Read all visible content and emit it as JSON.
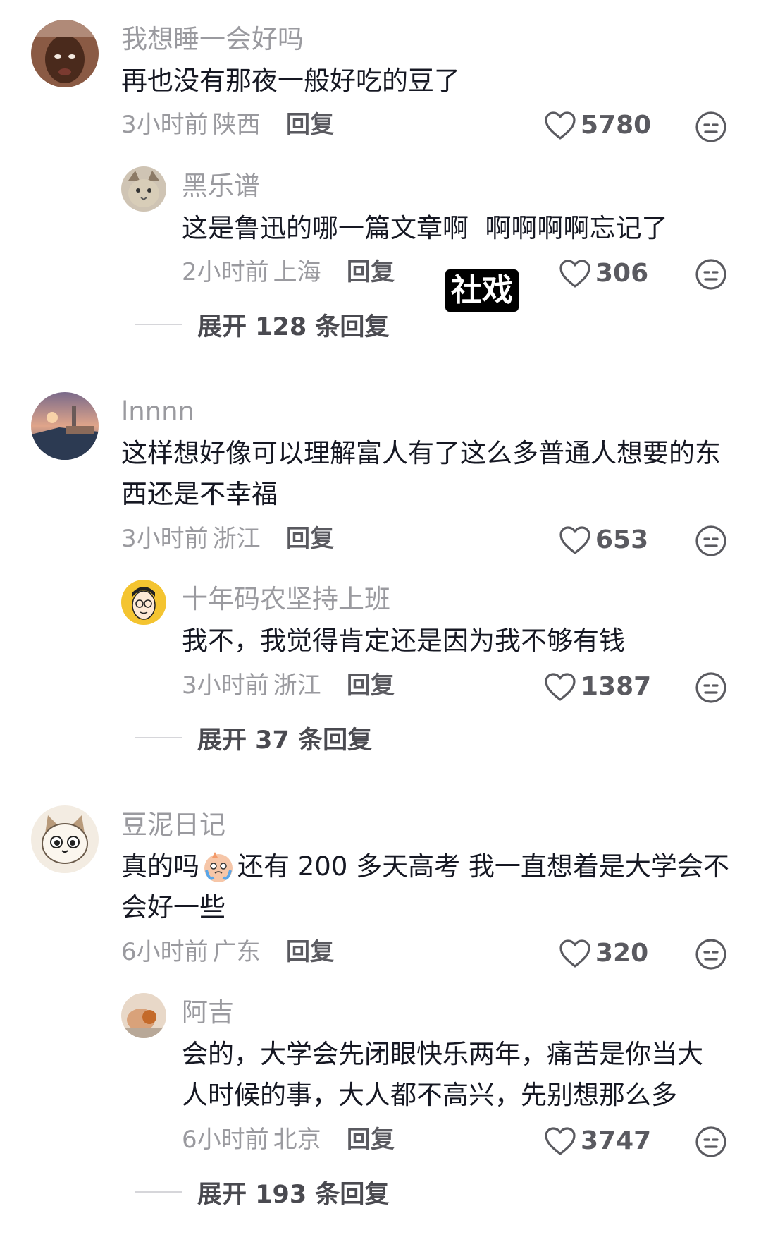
{
  "comments": [
    {
      "username": "我想睡一会好吗",
      "text": "再也没有那夜一般好吃的豆了",
      "time": "3小时前",
      "region": "陕西",
      "reply_label": "回复",
      "likes": "5780",
      "avatar_icon": "avatar-photo-man",
      "reply": {
        "username": "黑乐谱",
        "text": "这是鲁迅的哪一篇文章啊  啊啊啊啊忘记了",
        "time": "2小时前",
        "region": "上海",
        "reply_label": "回复",
        "likes": "306",
        "avatar_icon": "avatar-cat"
      },
      "expand_label": "展开 128 条回复"
    },
    {
      "username": "lnnnn",
      "text_lines": [
        "这样想好像可以理解富人有了这么多普通人想要的东",
        "西还是不幸福"
      ],
      "time": "3小时前",
      "region": "浙江",
      "reply_label": "回复",
      "likes": "653",
      "avatar_icon": "avatar-lake-town",
      "reply": {
        "username": "十年码农坚持上班",
        "text": "我不，我觉得肯定还是因为我不够有钱",
        "time": "3小时前",
        "region": "浙江",
        "reply_label": "回复",
        "likes": "1387",
        "avatar_icon": "avatar-cartoon-glasses"
      },
      "expand_label": "展开 37 条回复"
    },
    {
      "username": "豆泥日记",
      "text_lines": [
        "真的吗",
        "还有 200 多天高考 我一直想着是大学会不",
        "会好一些"
      ],
      "time": "6小时前",
      "region": "广东",
      "reply_label": "回复",
      "likes": "320",
      "avatar_icon": "avatar-cartoon-cat",
      "reply": {
        "username": "阿吉",
        "text_lines": [
          "会的，大学会先闭眼快乐两年，痛苦是你当大",
          "人时候的事，大人都不高兴，先别想那么多"
        ],
        "time": "6小时前",
        "region": "北京",
        "reply_label": "回复",
        "likes": "3747",
        "avatar_icon": "avatar-photo-hand"
      },
      "expand_label": "展开 193 条回复"
    }
  ],
  "overlay": {
    "tag": "社戏"
  },
  "icons": {
    "like": "heart-outline-icon",
    "dislike": "neutral-face-icon",
    "emoji": "crying-emoji-icon"
  },
  "colors": {
    "text": "#161823",
    "secondary": "#9a9a9f",
    "divider": "#d6d6da"
  }
}
